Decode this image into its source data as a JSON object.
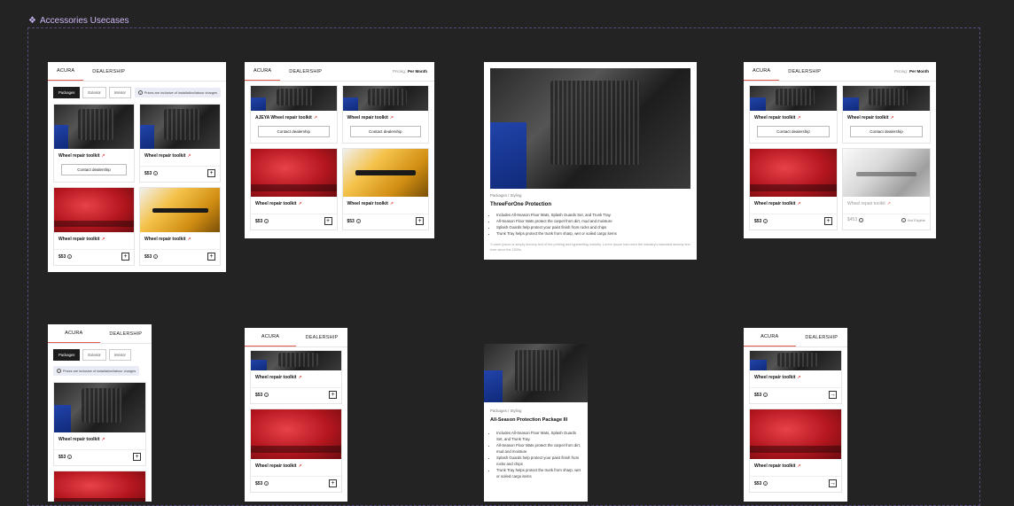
{
  "section": {
    "title": "Accessories Usecases"
  },
  "tabs": {
    "acura": "ACURA",
    "dealership": "DEALERSHIP"
  },
  "pricing": {
    "label": "Pricing:",
    "value": "Per Month"
  },
  "filters": {
    "packages": "Packages",
    "exterior": "Exterior",
    "interior": "Interior"
  },
  "note": "Prices are inclusive of installation/labour charges",
  "product": {
    "name": "Wheel repair toolkit",
    "name_alt": "AJEYA Wheel repair toolkit",
    "contact": "Contact dealership",
    "price": "$53",
    "price_na": "$453",
    "not_eligible": "Not Eligible"
  },
  "detail1": {
    "breadcrumb": "Packages / Styling",
    "title": "ThreeForOne Protection",
    "bullets": [
      "Includes All-Season Floor Mats, Splash Guards Set, and Trunk Tray.",
      "All-Season Floor Mats protect the carpet from dirt, mud and moisture",
      "Splash Guards help protect your paint finish from rocks and chips",
      "Trunk Tray helps protect the trunk from sharp, wet or soiled cargo items"
    ],
    "lorem": "*Lorem Ipsum is simply dummy text of the printing and typesetting industry. Lorem Ipsum has been the industry's standard dummy text ever since the 1500s"
  },
  "detail2": {
    "breadcrumb": "Packages / Styling",
    "title": "All-Season Protection Package III",
    "bullets": [
      "Includes All-Season Floor Mats, Splash Guards Set, and Trunk Tray.",
      "All-Season Floor Mats protect the carpet from dirt, mud and moisture",
      "Splash Guards help protect your paint finish from rocks and chips",
      "Trunk Tray helps protect the trunk from sharp, wet or soiled cargo items"
    ]
  },
  "colors": {
    "accent": "#e0584d",
    "bg": "#232323",
    "label": "#c9b6f2"
  }
}
